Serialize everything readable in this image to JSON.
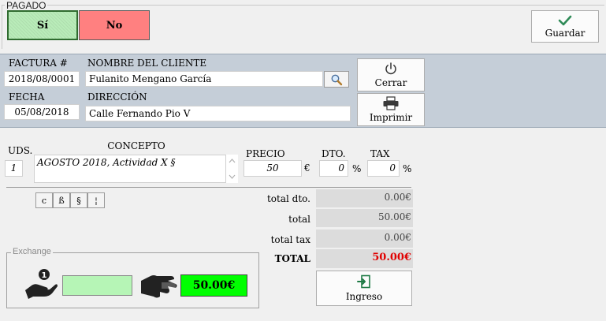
{
  "pagado": {
    "legend": "PAGADO",
    "si_label": "Sí",
    "no_label": "No"
  },
  "toolbar": {
    "guardar_label": "Guardar",
    "cerrar_label": "Cerrar",
    "imprimir_label": "Imprimir"
  },
  "invoice": {
    "factura_label": "FACTURA #",
    "factura_value": "2018/08/0001",
    "cliente_label": "NOMBRE DEL CLIENTE",
    "cliente_value": "Fulanito Mengano García",
    "fecha_label": "FECHA",
    "fecha_value": "05/08/2018",
    "direccion_label": "DIRECCIÓN",
    "direccion_value": "Calle Fernando Pio V"
  },
  "line": {
    "uds_label": "UDS.",
    "uds_value": "1",
    "concepto_label": "CONCEPTO",
    "concepto_value": "AGOSTO 2018, Actividad X §",
    "precio_label": "PRECIO",
    "precio_value": "50",
    "currency": "€",
    "dto_label": "DTO.",
    "dto_value": "0",
    "tax_label": "TAX",
    "tax_value": "0",
    "percent": "%"
  },
  "symbols": [
    "c",
    "ß",
    "§",
    "¦"
  ],
  "totals": {
    "dto_label": "total dto.",
    "dto_value": "0.00€",
    "total_label": "total",
    "total_value": "50.00€",
    "tax_label": "total tax",
    "tax_value": "0.00€",
    "grand_label": "TOTAL",
    "grand_value": "50.00€"
  },
  "exchange": {
    "legend": "Exchange",
    "received_value": "",
    "change_value": "50.00€"
  },
  "ingreso_label": "Ingreso",
  "colors": {
    "si_bg": "#b9ecb9",
    "no_bg": "#ff8080",
    "panel_bg": "#c5ced8",
    "total_red": "#e00000",
    "change_green": "#00ff00",
    "check_green": "#2e8b57"
  }
}
